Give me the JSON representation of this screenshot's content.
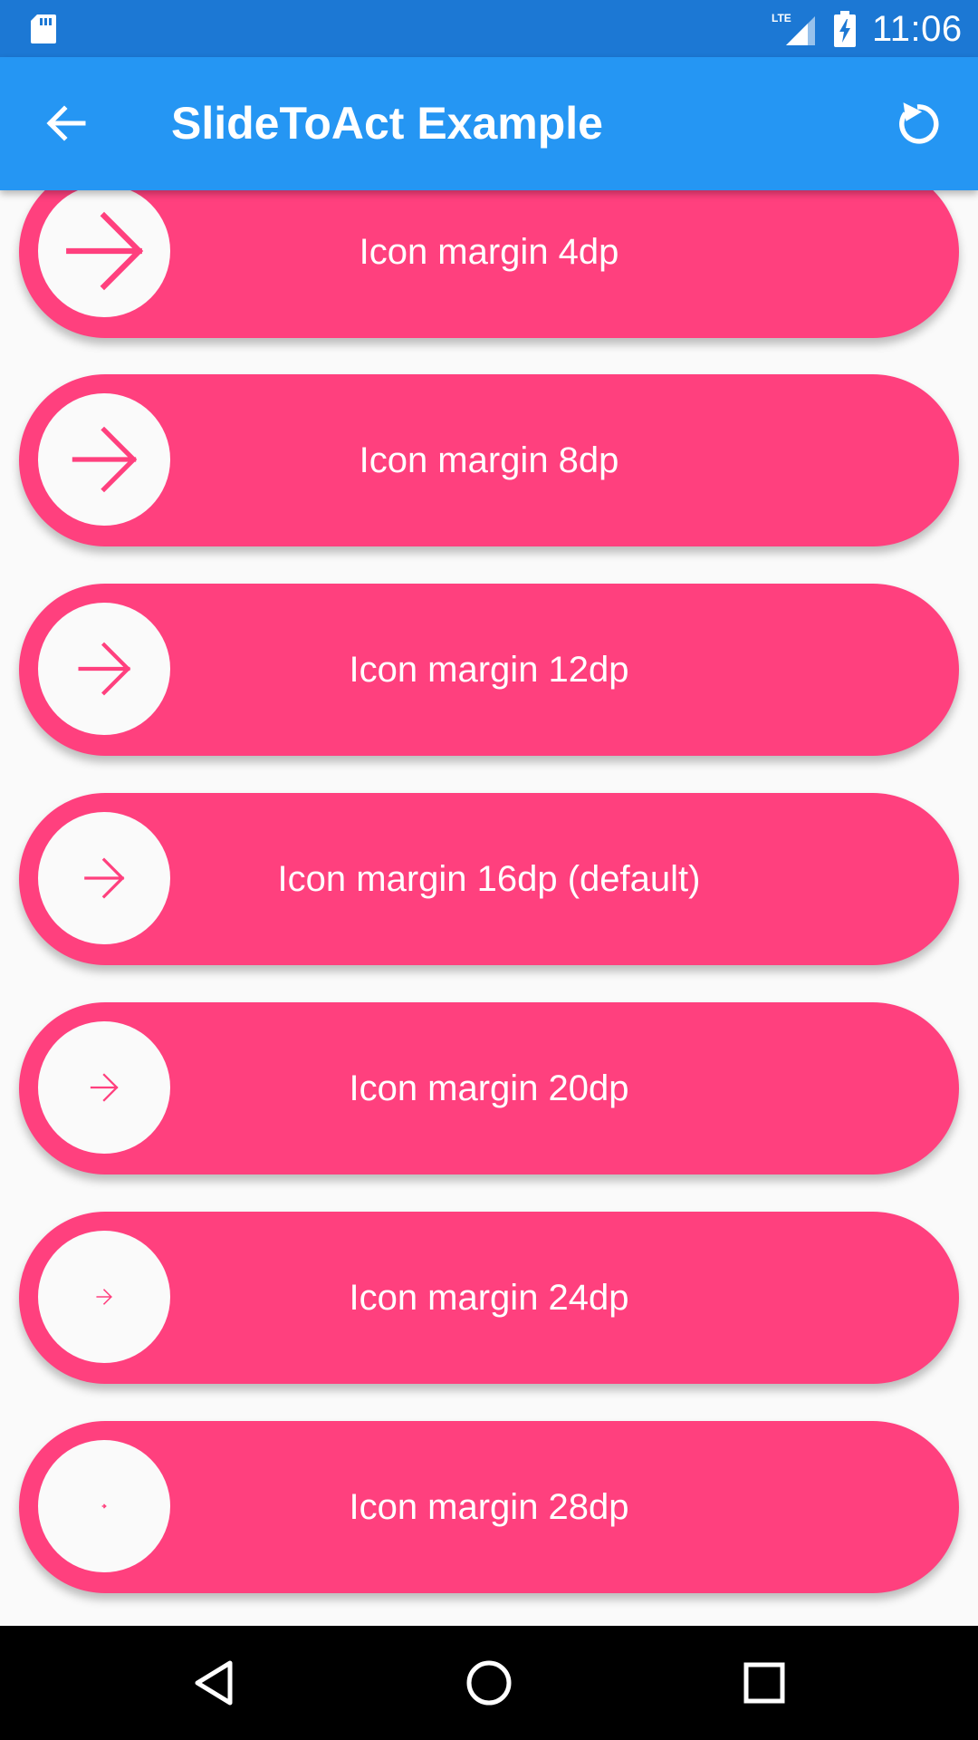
{
  "status_bar": {
    "time": "11:06",
    "network": "LTE",
    "icons": [
      "sd-card-icon",
      "lte-signal-icon",
      "battery-charging-icon"
    ]
  },
  "app_bar": {
    "title": "SlideToAct Example",
    "icons": [
      "back-arrow-icon",
      "refresh-icon"
    ]
  },
  "sliders": [
    {
      "label": "Icon margin 4dp",
      "icon_margin_dp": 4
    },
    {
      "label": "Icon margin 8dp",
      "icon_margin_dp": 8
    },
    {
      "label": "Icon margin 12dp",
      "icon_margin_dp": 12
    },
    {
      "label": "Icon margin 16dp (default)",
      "icon_margin_dp": 16
    },
    {
      "label": "Icon margin 20dp",
      "icon_margin_dp": 20
    },
    {
      "label": "Icon margin 24dp",
      "icon_margin_dp": 24
    },
    {
      "label": "Icon margin 28dp",
      "icon_margin_dp": 28
    }
  ],
  "nav_bar": {
    "icons": [
      "nav-back-icon",
      "nav-home-icon",
      "nav-recents-icon"
    ]
  },
  "colors": {
    "status_bar": "#1c78d4",
    "app_bar": "#2596f3",
    "slider": "#ff407e",
    "background": "#fafafa"
  }
}
